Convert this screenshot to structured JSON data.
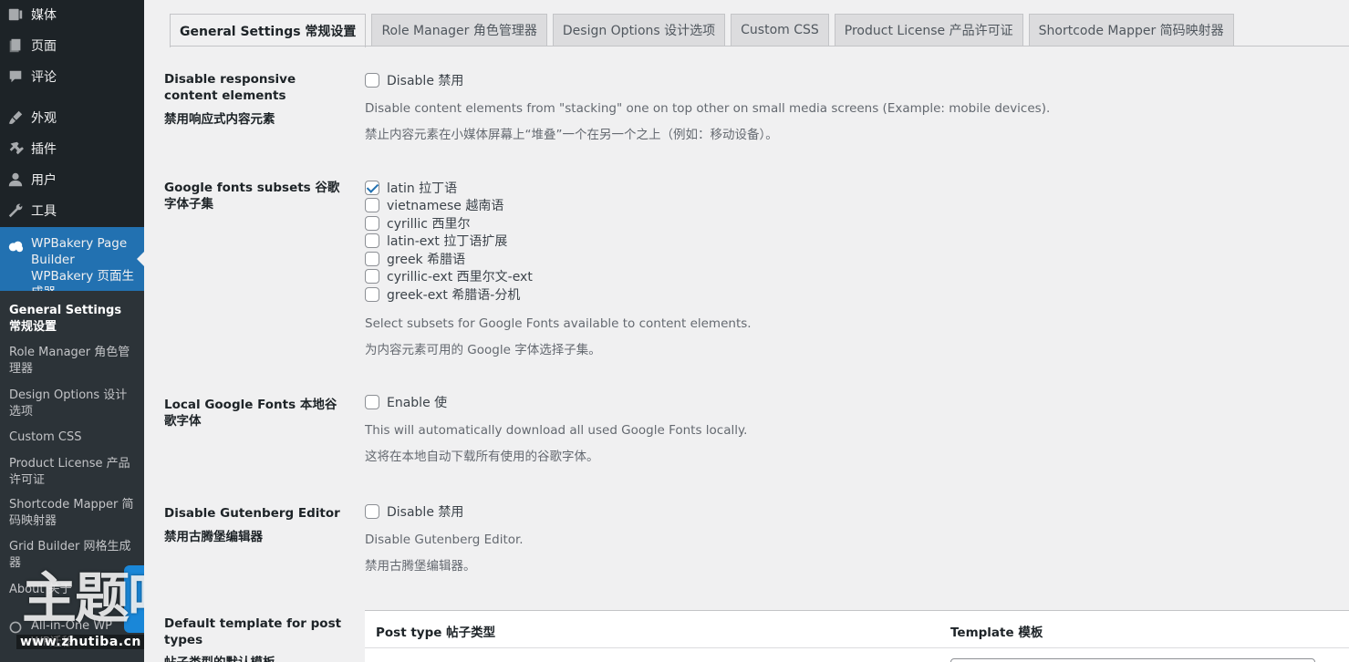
{
  "sidebar": {
    "menu": [
      {
        "label": "媒体",
        "icon": "media-icon"
      },
      {
        "label": "页面",
        "icon": "pages-icon"
      },
      {
        "label": "评论",
        "icon": "comments-icon"
      },
      {
        "label": "外观",
        "icon": "appearance-icon"
      },
      {
        "label": "插件",
        "icon": "plugins-icon"
      },
      {
        "label": "用户",
        "icon": "users-icon"
      },
      {
        "label": "工具",
        "icon": "tools-icon"
      }
    ],
    "active_plugin": {
      "label": "WPBakery Page Builder WPBakery 页面生成器",
      "icon": "wpbakery-cloud-icon"
    },
    "submenu": [
      {
        "label": "General Settings 常规设置",
        "current": true
      },
      {
        "label": "Role Manager 角色管理器"
      },
      {
        "label": "Design Options 设计选项"
      },
      {
        "label": "Custom CSS"
      },
      {
        "label": "Product License 产品许可证"
      },
      {
        "label": "Shortcode Mapper 简码映射器"
      },
      {
        "label": "Grid Builder 网格生成器"
      },
      {
        "label": "About 关于"
      }
    ],
    "after_menu": {
      "label": "All-in-One WP WP迁移",
      "icon": "migration-icon"
    }
  },
  "watermark": {
    "text": "主题吧",
    "url": "www.zhutiba.cn"
  },
  "tabs": [
    {
      "label": "General Settings  常规设置",
      "active": true
    },
    {
      "label": "Role Manager  角色管理器"
    },
    {
      "label": "Design Options  设计选项"
    },
    {
      "label": "Custom CSS"
    },
    {
      "label": "Product License  产品许可证"
    },
    {
      "label": "Shortcode Mapper  简码映射器"
    }
  ],
  "settings": {
    "responsive": {
      "label_en": "Disable responsive content elements",
      "label_zh": "禁用响应式内容元素",
      "checkbox": "Disable  禁用",
      "checked": false,
      "desc_en": "Disable content elements from \"stacking\" one on top other on small media screens (Example: mobile devices).",
      "desc_zh": "禁止内容元素在小媒体屏幕上“堆叠”一个在另一个之上（例如：移动设备）。"
    },
    "fonts_subsets": {
      "label": "Google fonts subsets 谷歌字体子集",
      "options": [
        {
          "label": "latin  拉丁语",
          "checked": true
        },
        {
          "label": "vietnamese  越南语",
          "checked": false
        },
        {
          "label": "cyrillic  西里尔",
          "checked": false
        },
        {
          "label": "latin-ext  拉丁语扩展",
          "checked": false
        },
        {
          "label": "greek  希腊语",
          "checked": false
        },
        {
          "label": "cyrillic-ext  西里尔文-ext",
          "checked": false
        },
        {
          "label": "greek-ext  希腊语-分机",
          "checked": false
        }
      ],
      "desc_en": "Select subsets for Google Fonts available to content elements.",
      "desc_zh": "为内容元素可用的 Google 字体选择子集。"
    },
    "local_fonts": {
      "label": "Local Google Fonts 本地谷歌字体",
      "checkbox": "Enable  使",
      "checked": false,
      "desc_en": "This will automatically download all used Google Fonts locally.",
      "desc_zh": "这将在本地自动下载所有使用的谷歌字体。"
    },
    "gutenberg": {
      "label_en": "Disable Gutenberg Editor",
      "label_zh": "禁用古腾堡编辑器",
      "checkbox": "Disable  禁用",
      "checked": false,
      "desc_en": "Disable Gutenberg Editor.",
      "desc_zh": "禁用古腾堡编辑器。"
    },
    "default_template": {
      "label_en": "Default template for post types",
      "label_zh": "帖子类型的默认模板",
      "col_post_type": "Post type 帖子类型",
      "col_template": "Template 模板"
    }
  }
}
